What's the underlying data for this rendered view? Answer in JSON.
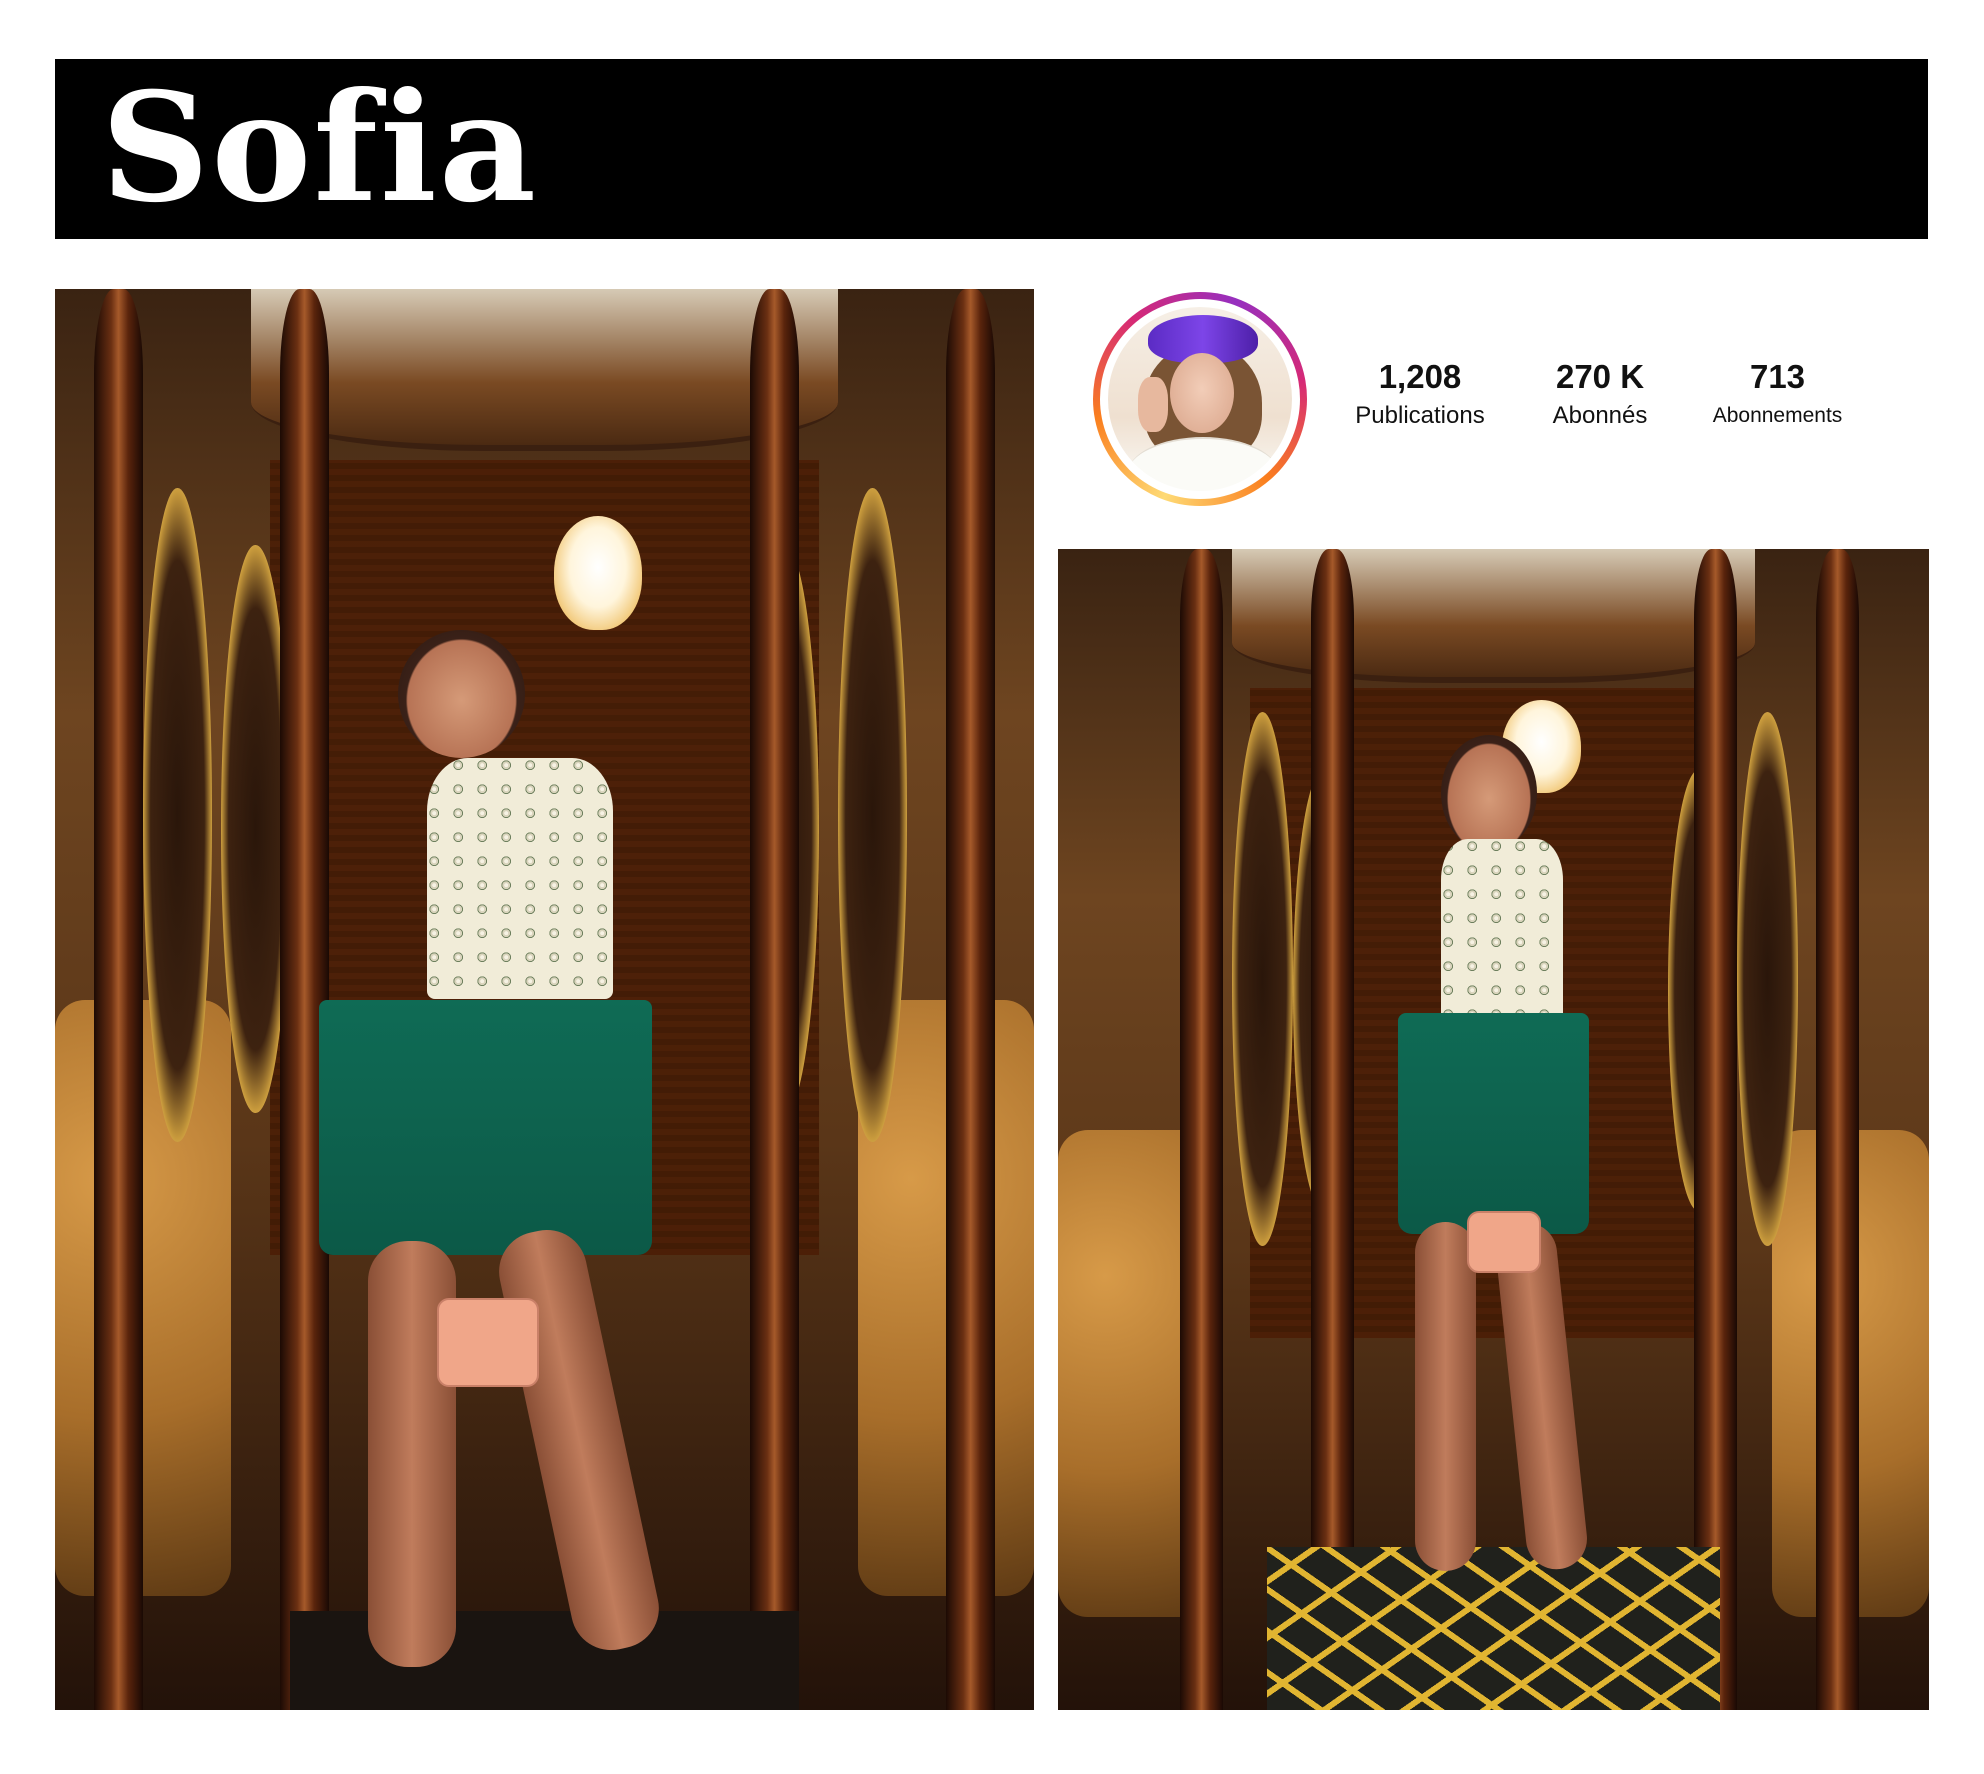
{
  "header": {
    "title": "Sofia"
  },
  "profile": {
    "stats": [
      {
        "value": "1,208",
        "label": "Publications"
      },
      {
        "value": "270 K",
        "label": "Abonnés"
      },
      {
        "value": "713",
        "label": "Abonnements"
      }
    ]
  },
  "colors": {
    "title_bar": "#000000",
    "title_text": "#ffffff",
    "background": "#ffffff",
    "avatar_ring": [
      "#feda75",
      "#fa7e1e",
      "#d62976",
      "#962fbf"
    ]
  }
}
